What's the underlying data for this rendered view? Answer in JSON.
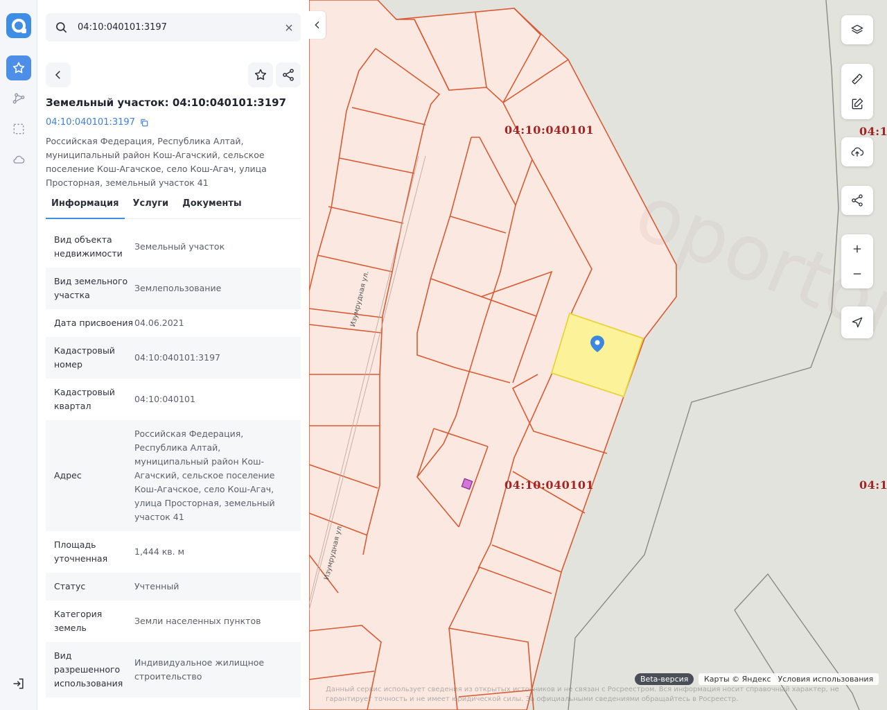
{
  "search": {
    "value": "04:10:040101:3197"
  },
  "object": {
    "title": "Земельный участок: 04:10:040101:3197",
    "cadastral_link": "04:10:040101:3197",
    "address": "Российская Федерация, Республика Алтай, муниципальный район Кош-Агачский, сельское поселение Кош-Агачское, село Кош-Агач, улица Просторная, земельный участок 41"
  },
  "tabs": [
    {
      "label": "Информация"
    },
    {
      "label": "Услуги"
    },
    {
      "label": "Документы"
    }
  ],
  "rows": [
    {
      "key": "Вид объекта недвижимости",
      "value": "Земельный участок"
    },
    {
      "key": "Вид земельного участка",
      "value": "Землепользование"
    },
    {
      "key": "Дата присвоения",
      "value": "04.06.2021"
    },
    {
      "key": "Кадастровый номер",
      "value": "04:10:040101:3197"
    },
    {
      "key": "Кадастровый квартал",
      "value": "04:10:040101"
    },
    {
      "key": "Адрес",
      "value": "Российская Федерация, Республика Алтай, муниципальный район Кош-Агачский, сельское поселение Кош-Агачское, село Кош-Агач, улица Просторная, земельный участок 41"
    },
    {
      "key": "Площадь уточненная",
      "value": "1,444 кв. м"
    },
    {
      "key": "Статус",
      "value": "Учтенный"
    },
    {
      "key": "Категория земель",
      "value": "Земли населенных пунктов"
    },
    {
      "key": "Вид разрешенного использования",
      "value": "Индивидуальное жилищное строительство"
    }
  ],
  "map": {
    "quarter_labels": [
      "04:10:040101",
      "04:10:040101",
      "04:1",
      "04:1"
    ],
    "streets": [
      "Изумрудная ул.",
      "Изумрудная ул."
    ],
    "watermark": "oportonoshop",
    "beta": "Beta-версия",
    "attribution": "Карты © Яндекс",
    "terms": "Условия использования",
    "disclaimer": "Данный сервис использует сведения из открытых источников и не связан с Росреестром. Вся информация носит справочный характер, не гарантирует точность и не имеет юридической силы. За официальными сведениями обращайтесь в Росреестр."
  },
  "colors": {
    "accent": "#3e8ee6",
    "parcel_fill": "#fbe9e1",
    "parcel_stroke": "#d95a32",
    "selected_fill": "#fbf29a",
    "quarter_label": "#a22424"
  }
}
